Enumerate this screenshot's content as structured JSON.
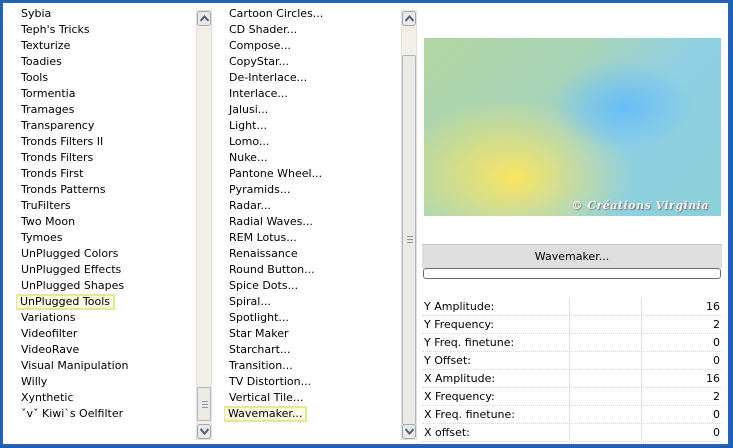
{
  "left_list": {
    "items": [
      {
        "label": "Sybia",
        "highlight": false
      },
      {
        "label": "Teph's Tricks",
        "highlight": false
      },
      {
        "label": "Texturize",
        "highlight": false
      },
      {
        "label": "Toadies",
        "highlight": false
      },
      {
        "label": "Tools",
        "highlight": false
      },
      {
        "label": "Tormentia",
        "highlight": false
      },
      {
        "label": "Tramages",
        "highlight": false
      },
      {
        "label": "Transparency",
        "highlight": false
      },
      {
        "label": "Tronds Filters II",
        "highlight": false
      },
      {
        "label": "Tronds Filters",
        "highlight": false
      },
      {
        "label": "Tronds First",
        "highlight": false
      },
      {
        "label": "Tronds Patterns",
        "highlight": false
      },
      {
        "label": "TruFilters",
        "highlight": false
      },
      {
        "label": "Two Moon",
        "highlight": false
      },
      {
        "label": "Tymoes",
        "highlight": false
      },
      {
        "label": "UnPlugged Colors",
        "highlight": false
      },
      {
        "label": "UnPlugged Effects",
        "highlight": false
      },
      {
        "label": "UnPlugged Shapes",
        "highlight": false
      },
      {
        "label": "UnPlugged Tools",
        "highlight": true
      },
      {
        "label": "Variations",
        "highlight": false
      },
      {
        "label": "Videofilter",
        "highlight": false
      },
      {
        "label": "VideoRave",
        "highlight": false
      },
      {
        "label": "Visual Manipulation",
        "highlight": false
      },
      {
        "label": "Willy",
        "highlight": false
      },
      {
        "label": "Xynthetic",
        "highlight": false
      },
      {
        "label": "ˇvˇ Kiwi`s Oelfilter",
        "highlight": false
      }
    ]
  },
  "mid_list": {
    "items": [
      {
        "label": "Cartoon Circles...",
        "highlight": false
      },
      {
        "label": "CD Shader...",
        "highlight": false
      },
      {
        "label": "Compose...",
        "highlight": false
      },
      {
        "label": "CopyStar...",
        "highlight": false
      },
      {
        "label": "De-Interlace...",
        "highlight": false
      },
      {
        "label": "Interlace...",
        "highlight": false
      },
      {
        "label": "Jalusi...",
        "highlight": false
      },
      {
        "label": "Light...",
        "highlight": false
      },
      {
        "label": "Lomo...",
        "highlight": false
      },
      {
        "label": "Nuke...",
        "highlight": false
      },
      {
        "label": "Pantone Wheel...",
        "highlight": false
      },
      {
        "label": "Pyramids...",
        "highlight": false
      },
      {
        "label": "Radar...",
        "highlight": false
      },
      {
        "label": "Radial Waves...",
        "highlight": false
      },
      {
        "label": "REM Lotus...",
        "highlight": false
      },
      {
        "label": "Renaissance",
        "highlight": false
      },
      {
        "label": "Round Button...",
        "highlight": false
      },
      {
        "label": "Spice Dots...",
        "highlight": false
      },
      {
        "label": "Spiral...",
        "highlight": false
      },
      {
        "label": "Spotlight...",
        "highlight": false
      },
      {
        "label": "Star Maker",
        "highlight": false
      },
      {
        "label": "Starchart...",
        "highlight": false
      },
      {
        "label": "Transition...",
        "highlight": false
      },
      {
        "label": "TV Distortion...",
        "highlight": false
      },
      {
        "label": "Vertical Tile...",
        "highlight": false
      },
      {
        "label": "Wavemaker...",
        "highlight": true
      }
    ]
  },
  "preview": {
    "watermark": "© Créations Virginia"
  },
  "filter_title": "Wavemaker...",
  "params": [
    {
      "name": "Y Amplitude:",
      "value": "16"
    },
    {
      "name": "Y Frequency:",
      "value": "2"
    },
    {
      "name": "Y Freq. finetune:",
      "value": "0"
    },
    {
      "name": "Y Offset:",
      "value": "0"
    },
    {
      "name": "X Amplitude:",
      "value": "16"
    },
    {
      "name": "X Frequency:",
      "value": "2"
    },
    {
      "name": "X Freq. finetune:",
      "value": "0"
    },
    {
      "name": "X offset:",
      "value": "0"
    }
  ]
}
